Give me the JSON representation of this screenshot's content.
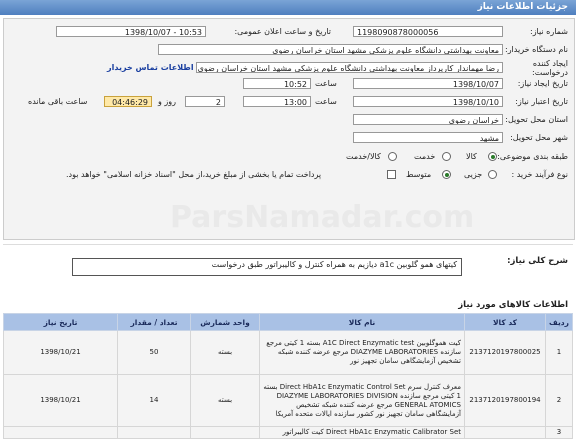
{
  "header": {
    "title": "جزئیات اطلاعات نیاز"
  },
  "form": {
    "need_number_label": "شماره نیاز:",
    "need_number": "1198090878000056",
    "announce_label": "تاریخ و ساعت اعلان عمومی:",
    "announce_value": "1398/10/07 - 10:53",
    "buyer_org_label": "نام دستگاه خریدار:",
    "buyer_org": "معاونت بهداشتی دانشگاه علوم پزشکی مشهد استان خراسان رضوی",
    "creator_label": "ایجاد کننده درخواست:",
    "creator": "رضا مهماندار کارپرداز معاونت بهداشتی دانشگاه علوم پزشکی مشهد استان خراسان رضوی",
    "contact_link": "اطلاعات تماس خریدار",
    "create_date_label": "تاریخ ایجاد نیاز:",
    "create_date": "1398/10/07",
    "time_label": "ساعت",
    "create_time": "10:52",
    "deadline_label": "تاریخ اعتبار نیاز:",
    "deadline_date": "1398/10/10",
    "deadline_time": "13:00",
    "days_label": "روز و",
    "days": "2",
    "remain_time": "04:46:29",
    "remain_label": "ساعت باقی مانده",
    "province_label": "استان محل تحویل:",
    "province": "خراسان رضوی",
    "city_label": "شهر محل تحویل:",
    "city": "مشهد",
    "category_label": "طبقه بندی موضوعی:",
    "cat_goods": "کالا",
    "cat_service": "خدمت",
    "cat_goods_service": "کالا/خدمت",
    "purchase_type_label": "نوع فرآیند خرید :",
    "type_partial": "جزیی",
    "type_medium": "متوسط",
    "payment_note": "پرداخت تمام یا بخشی از مبلغ خرید،از محل \"اسناد خزانه اسلامی\" خواهد بود."
  },
  "description": {
    "label": "شرح کلی نیاز:",
    "text": "کیتهای همو گلوبین a1c دیازیم به همراه کنترل و کالیبراتور طبق درخواست"
  },
  "goods": {
    "section_title": "اطلاعات کالاهای مورد نیاز",
    "columns": [
      "ردیف",
      "کد کالا",
      "نام کالا",
      "واحد شمارش",
      "تعداد / مقدار",
      "تاریخ نیاز"
    ],
    "rows": [
      {
        "row": "1",
        "code": "2137120197800025",
        "name": "کیت هموگلوبین A1C Direct Enzymatic test بسته 1 کیتی مرجع سازنده DIAZYME LABORATORIES مرجع عرضه کننده شبکه تشخیص آزمایشگاهی سامان تجهیز نور",
        "unit": "بسته",
        "qty": "50",
        "date": "1398/10/21"
      },
      {
        "row": "2",
        "code": "2137120197800194",
        "name": "معرف کنترل سرم Direct HbA1c Enzymatic Control Set بسته 1 کیتی مرجع سازنده DIAZYME LABORATORIES DIVISION GENERAL ATOMICS مرجع عرضه کننده شبکه تشخیص آزمایشگاهی سامان تجهیز نور کشور سازنده ایالات متحده آمریکا",
        "unit": "بسته",
        "qty": "14",
        "date": "1398/10/21"
      },
      {
        "row": "3",
        "code": "",
        "name": "Direct HbA1c Enzymatic Calibrator Set کیت کالیبراتور",
        "unit": "",
        "qty": "",
        "date": ""
      }
    ]
  },
  "watermark": "ParsNamadar.com"
}
